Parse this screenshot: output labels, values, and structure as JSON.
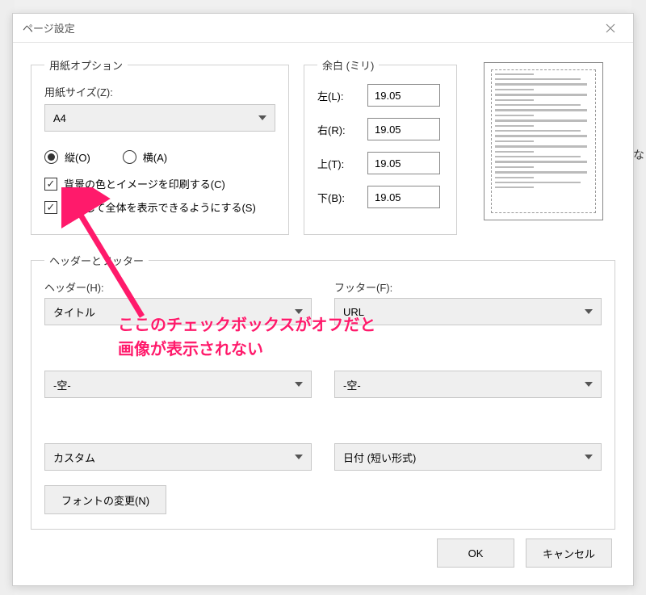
{
  "dialog": {
    "title": "ページ設定"
  },
  "paper": {
    "legend": "用紙オプション",
    "size_label": "用紙サイズ(Z):",
    "size_value": "A4",
    "orient_portrait": "縦(O)",
    "orient_landscape": "横(A)",
    "print_bg": "背景の色とイメージを印刷する(C)",
    "shrink_fit": "縮小して全体を表示できるようにする(S)"
  },
  "margins": {
    "legend": "余白 (ミリ)",
    "left_label": "左(L):",
    "right_label": "右(R):",
    "top_label": "上(T):",
    "bottom_label": "下(B):",
    "left": "19.05",
    "right": "19.05",
    "top": "19.05",
    "bottom": "19.05"
  },
  "hf": {
    "legend": "ヘッダーとフッター",
    "header_label": "ヘッダー(H):",
    "footer_label": "フッター(F):",
    "header_1": "タイトル",
    "footer_1": "URL",
    "header_2": "-空-",
    "footer_2": "-空-",
    "header_3": "カスタム",
    "footer_3": "日付 (短い形式)",
    "font_button": "フォントの変更(N)"
  },
  "buttons": {
    "ok": "OK",
    "cancel": "キャンセル"
  },
  "annotation": {
    "line1": "ここのチェックボックスがオフだと",
    "line2": "画像が表示されない"
  },
  "bg": {
    "char": "な"
  }
}
